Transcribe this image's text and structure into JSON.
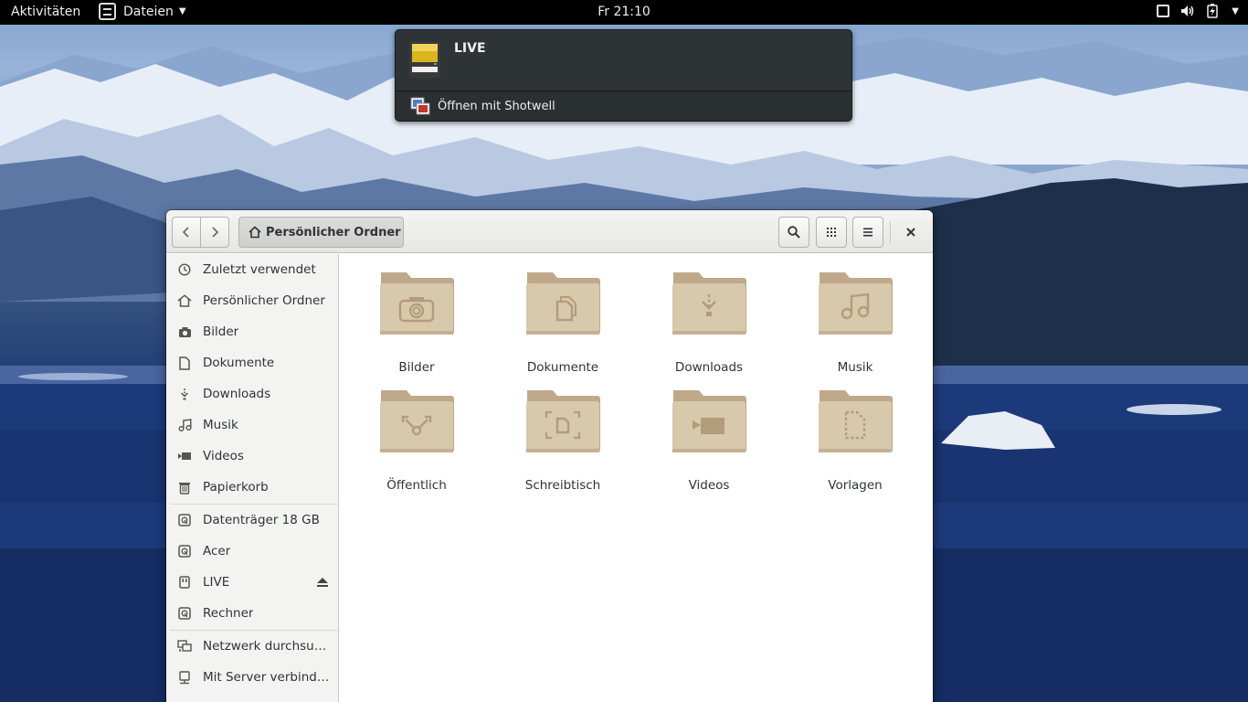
{
  "topbar": {
    "activities": "Aktivitäten",
    "app_menu": "Dateien",
    "clock": "Fr 21:10"
  },
  "notification": {
    "title": "LIVE",
    "action": "Öffnen mit Shotwell"
  },
  "window": {
    "path_button": "Persönlicher Ordner"
  },
  "sidebar": {
    "places": [
      {
        "label": "Zuletzt verwendet",
        "icon": "clock-icon"
      },
      {
        "label": "Persönlicher Ordner",
        "icon": "home-icon"
      },
      {
        "label": "Bilder",
        "icon": "camera-icon"
      },
      {
        "label": "Dokumente",
        "icon": "document-icon"
      },
      {
        "label": "Downloads",
        "icon": "download-icon"
      },
      {
        "label": "Musik",
        "icon": "music-icon"
      },
      {
        "label": "Videos",
        "icon": "video-icon"
      },
      {
        "label": "Papierkorb",
        "icon": "trash-icon"
      }
    ],
    "devices": [
      {
        "label": "Datenträger 18 GB",
        "icon": "drive-icon"
      },
      {
        "label": "Acer",
        "icon": "drive-icon"
      },
      {
        "label": "LIVE",
        "icon": "usb-drive-icon"
      },
      {
        "label": "Rechner",
        "icon": "drive-icon"
      }
    ],
    "network": [
      {
        "label": "Netzwerk durchsuc…",
        "icon": "network-icon"
      },
      {
        "label": "Mit Server verbinden",
        "icon": "server-icon"
      }
    ]
  },
  "folders": [
    {
      "label": "Bilder",
      "icon": "camera-icon"
    },
    {
      "label": "Dokumente",
      "icon": "document-icon"
    },
    {
      "label": "Downloads",
      "icon": "download-icon"
    },
    {
      "label": "Musik",
      "icon": "music-icon"
    },
    {
      "label": "Öffentlich",
      "icon": "share-icon"
    },
    {
      "label": "Schreibtisch",
      "icon": "desktop-icon"
    },
    {
      "label": "Videos",
      "icon": "video-icon"
    },
    {
      "label": "Vorlagen",
      "icon": "template-icon"
    }
  ]
}
